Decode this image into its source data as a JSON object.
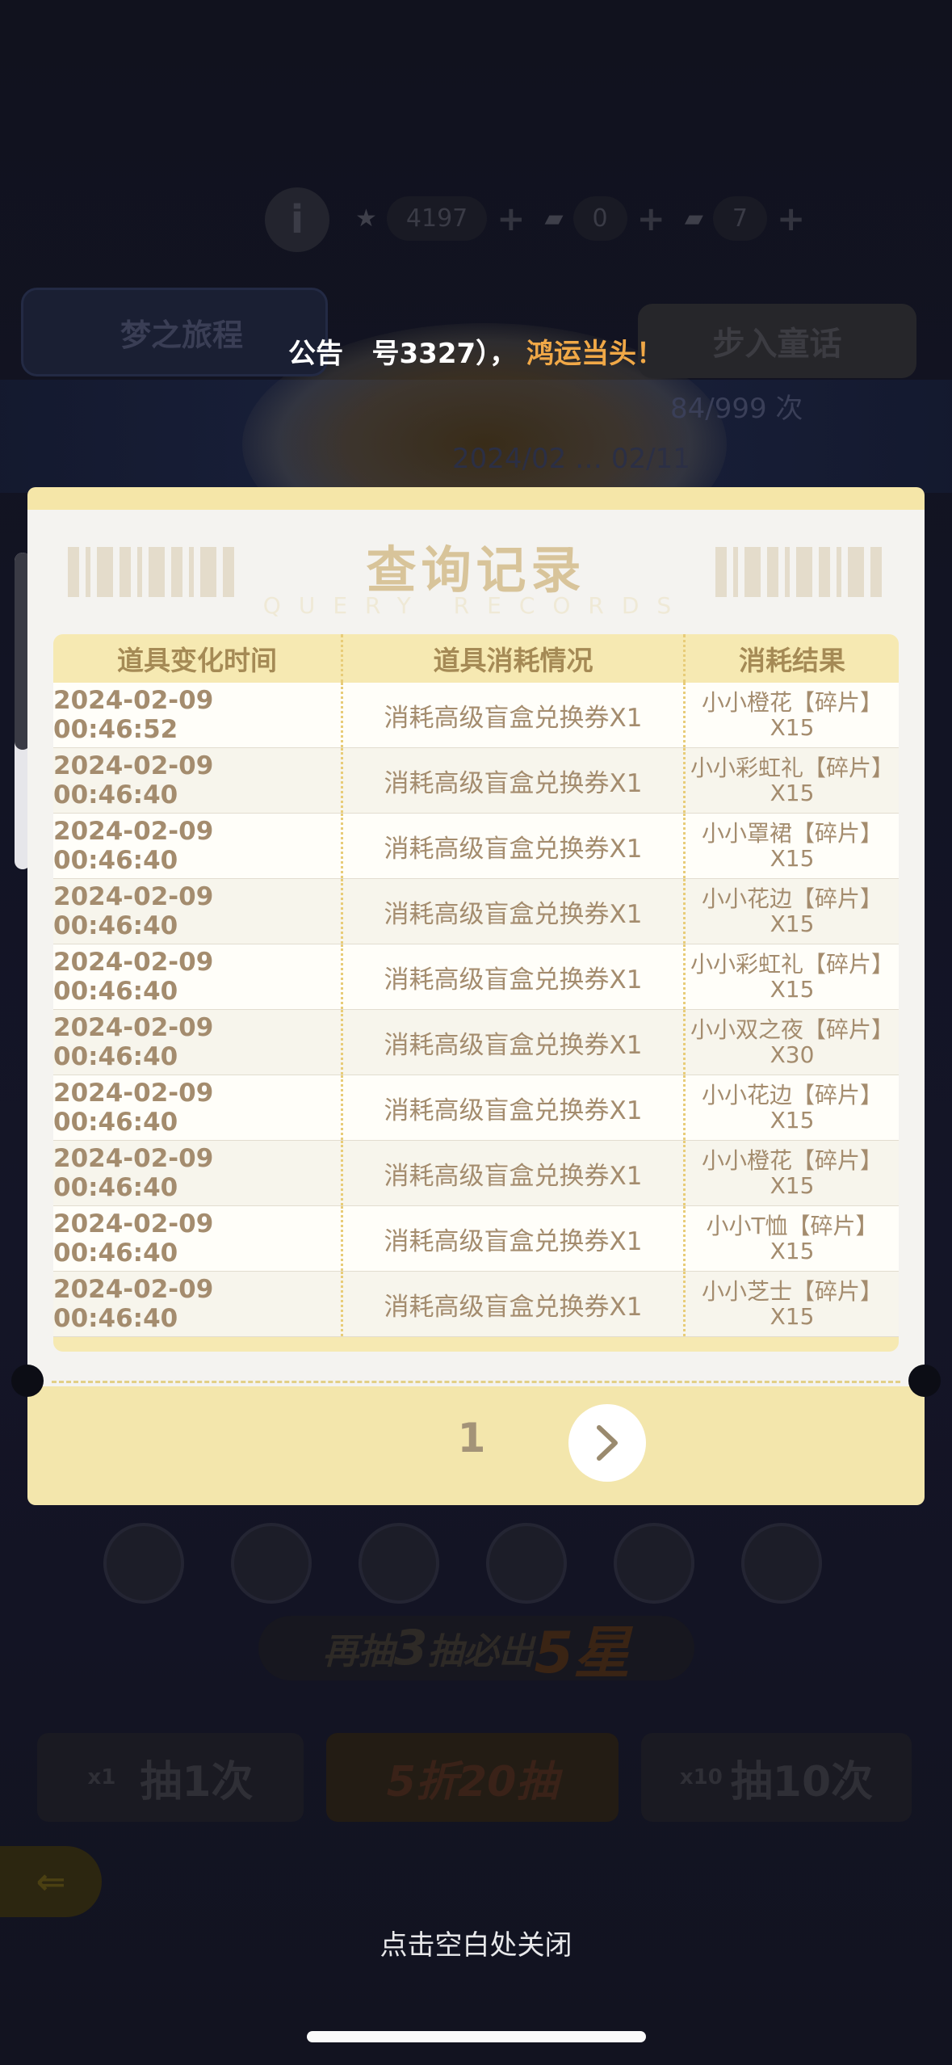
{
  "background": {
    "resources": [
      {
        "icon": "star-icon",
        "value": "4197"
      },
      {
        "icon": "ticket-icon",
        "value": "0"
      },
      {
        "icon": "ticket-icon",
        "value": "7"
      }
    ],
    "info_label": "i",
    "tab_left_label": "梦之旅程",
    "tab_right_label": "步入童话",
    "counter": "84/999 次",
    "date_range": "2024/02 … 02/11",
    "promo_prefix": "再抽",
    "promo_number": "3",
    "promo_middle": "抽必出",
    "promo_suffix": "5星",
    "draw_one_label": "抽1次",
    "draw_one_multiplier": "x1",
    "discount_label": "5折20抽",
    "draw_ten_label": "抽10次",
    "draw_ten_multiplier": "x10"
  },
  "announcement": {
    "label": "公告",
    "text": "号3327），",
    "highlight": "鸿运当头！"
  },
  "modal": {
    "title": "查询记录",
    "subtitle": "QUERY RECORDS",
    "columns": [
      "道具变化时间",
      "道具消耗情况",
      "消耗结果"
    ],
    "rows": [
      {
        "time": "2024-02-09 00:46:52",
        "usage": "消耗高级盲盒兑换券X1",
        "result": "小小橙花【碎片】X15"
      },
      {
        "time": "2024-02-09 00:46:40",
        "usage": "消耗高级盲盒兑换券X1",
        "result": "小小彩虹礼【碎片】X15"
      },
      {
        "time": "2024-02-09 00:46:40",
        "usage": "消耗高级盲盒兑换券X1",
        "result": "小小罩裙【碎片】X15"
      },
      {
        "time": "2024-02-09 00:46:40",
        "usage": "消耗高级盲盒兑换券X1",
        "result": "小小花边【碎片】X15"
      },
      {
        "time": "2024-02-09 00:46:40",
        "usage": "消耗高级盲盒兑换券X1",
        "result": "小小彩虹礼【碎片】X15"
      },
      {
        "time": "2024-02-09 00:46:40",
        "usage": "消耗高级盲盒兑换券X1",
        "result": "小小双之夜【碎片】X30"
      },
      {
        "time": "2024-02-09 00:46:40",
        "usage": "消耗高级盲盒兑换券X1",
        "result": "小小花边【碎片】X15"
      },
      {
        "time": "2024-02-09 00:46:40",
        "usage": "消耗高级盲盒兑换券X1",
        "result": "小小橙花【碎片】X15"
      },
      {
        "time": "2024-02-09 00:46:40",
        "usage": "消耗高级盲盒兑换券X1",
        "result": "小小T恤【碎片】X15"
      },
      {
        "time": "2024-02-09 00:46:40",
        "usage": "消耗高级盲盒兑换券X1",
        "result": "小小芝士【碎片】X15"
      }
    ],
    "page": "1",
    "next_icon": "chevron-right-icon"
  },
  "close_hint": "点击空白处关闭",
  "colors": {
    "accent": "#f0a847",
    "modal_header": "#f5e6a8",
    "table_text": "#a48c6e"
  }
}
